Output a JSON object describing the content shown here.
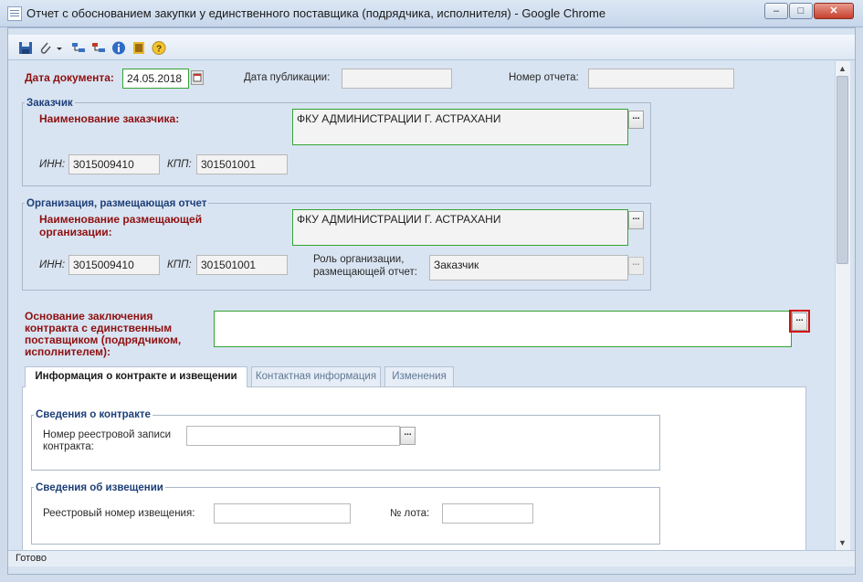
{
  "window": {
    "title": "Отчет с обоснованием закупки у единственного поставщика (подрядчика, исполнителя) - Google Chrome"
  },
  "toolbar": {
    "icons": [
      "save-icon",
      "attach-icon",
      "dropdown-arrow-icon",
      "tree-expand-icon",
      "tree-collapse-icon",
      "info-icon",
      "book-icon",
      "help-icon"
    ]
  },
  "header": {
    "doc_date_label": "Дата документа:",
    "doc_date_value": "24.05.2018",
    "pub_date_label": "Дата публикации:",
    "pub_date_value": "",
    "report_no_label": "Номер отчета:",
    "report_no_value": ""
  },
  "customer": {
    "group_title": "Заказчик",
    "name_label": "Наименование заказчика:",
    "name_value": "ФКУ АДМИНИСТРАЦИИ Г. АСТРАХАНИ",
    "inn_label": "ИНН:",
    "inn_value": "3015009410",
    "kpp_label": "КПП:",
    "kpp_value": "301501001"
  },
  "org": {
    "group_title": "Организация, размещающая отчет",
    "name_label_1": "Наименование размещающей",
    "name_label_2": "организации:",
    "name_value": "ФКУ АДМИНИСТРАЦИИ Г. АСТРАХАНИ",
    "inn_label": "ИНН:",
    "inn_value": "3015009410",
    "kpp_label": "КПП:",
    "kpp_value": "301501001",
    "role_label_1": "Роль организации,",
    "role_label_2": "размещающей отчет:",
    "role_value": "Заказчик"
  },
  "basis": {
    "label_1": "Основание заключения",
    "label_2": "контракта с единственным",
    "label_3": "поставщиком (подрядчиком,",
    "label_4": "исполнителем):",
    "value": ""
  },
  "tabs": [
    {
      "label": "Информация о контракте и извещении",
      "active": true
    },
    {
      "label": "Контактная информация",
      "active": false
    },
    {
      "label": "Изменения",
      "active": false
    }
  ],
  "contract": {
    "group_title": "Сведения о контракте",
    "reg_label_1": "Номер реестровой записи",
    "reg_label_2": "контракта:",
    "reg_value": ""
  },
  "notice": {
    "group_title": "Сведения об извещении",
    "reg_label": "Реестровый номер извещения:",
    "reg_value": "",
    "lot_label": "№ лота:",
    "lot_value": ""
  },
  "dots_label": "...",
  "status": {
    "text": "Готово"
  },
  "colors": {
    "required_label": "#8e1010",
    "group_title": "#1d3f78",
    "valid_border": "#33a333",
    "highlight": "#d01010"
  }
}
